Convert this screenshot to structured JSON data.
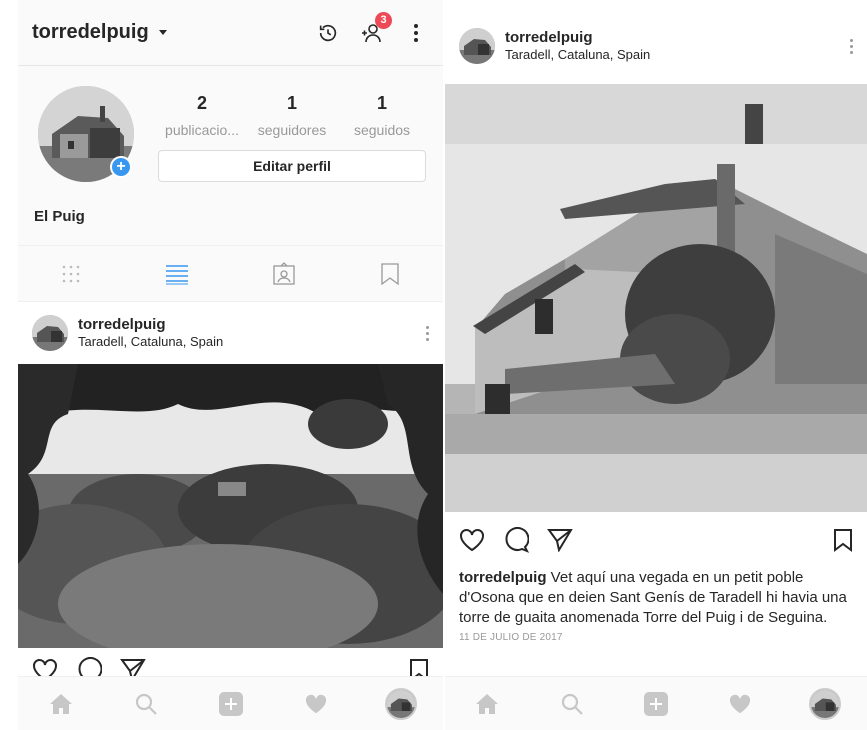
{
  "left": {
    "topbar": {
      "username": "torredelpuig",
      "notification_count": "3"
    },
    "profile": {
      "stats": [
        {
          "num": "2",
          "label": "publicacio..."
        },
        {
          "num": "1",
          "label": "seguidores"
        },
        {
          "num": "1",
          "label": "seguidos"
        }
      ],
      "edit_button": "Editar perfil",
      "display_name": "El Puig"
    },
    "post": {
      "username": "torredelpuig",
      "location": "Taradell, Cataluna, Spain"
    }
  },
  "right": {
    "post": {
      "username": "torredelpuig",
      "location": "Taradell, Cataluna, Spain",
      "caption_user": "torredelpuig",
      "caption_text": " Vet aquí una vegada en un petit poble d'Osona que en deien Sant Genís de Taradell hi havia una torre de guaita anomenada Torre del Puig i de Seguina.",
      "date": "11 DE JULIO DE 2017"
    }
  },
  "colors": {
    "badge": "#ed4956",
    "accent": "#3897f0",
    "nav_icon": "#c7c7c7"
  },
  "icons": [
    "history-icon",
    "add-person-icon",
    "more-vert-icon",
    "grid-icon",
    "list-icon",
    "tagged-icon",
    "saved-icon",
    "heart-icon",
    "comment-icon",
    "share-icon",
    "bookmark-icon",
    "home-icon",
    "search-icon",
    "add-icon",
    "activity-icon"
  ]
}
